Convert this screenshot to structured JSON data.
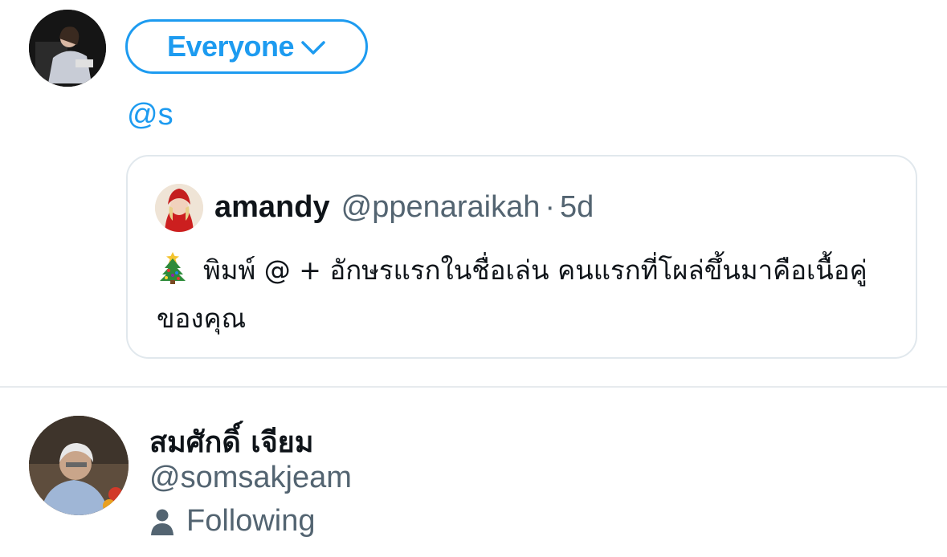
{
  "composer": {
    "audience_label": "Everyone",
    "text": "@s"
  },
  "quoted_tweet": {
    "name": "amandy",
    "handle": "@ppenaraikah",
    "separator": "·",
    "time": "5d",
    "body": "พิมพ์ @ + อักษรแรกในชื่อเล่น คนแรกที่โผล่ขึ้นมาคือเนื้อคู่ของคุณ",
    "emoji_icon": "christmas-tree-icon"
  },
  "suggestion": {
    "name": "สมศักดิ์ เจียม",
    "handle": "@somsakjeam",
    "status": "Following",
    "status_icon": "person-icon"
  },
  "colors": {
    "accent": "#1d9bf0",
    "secondary_text": "#536471",
    "border": "#e1e8ed"
  }
}
